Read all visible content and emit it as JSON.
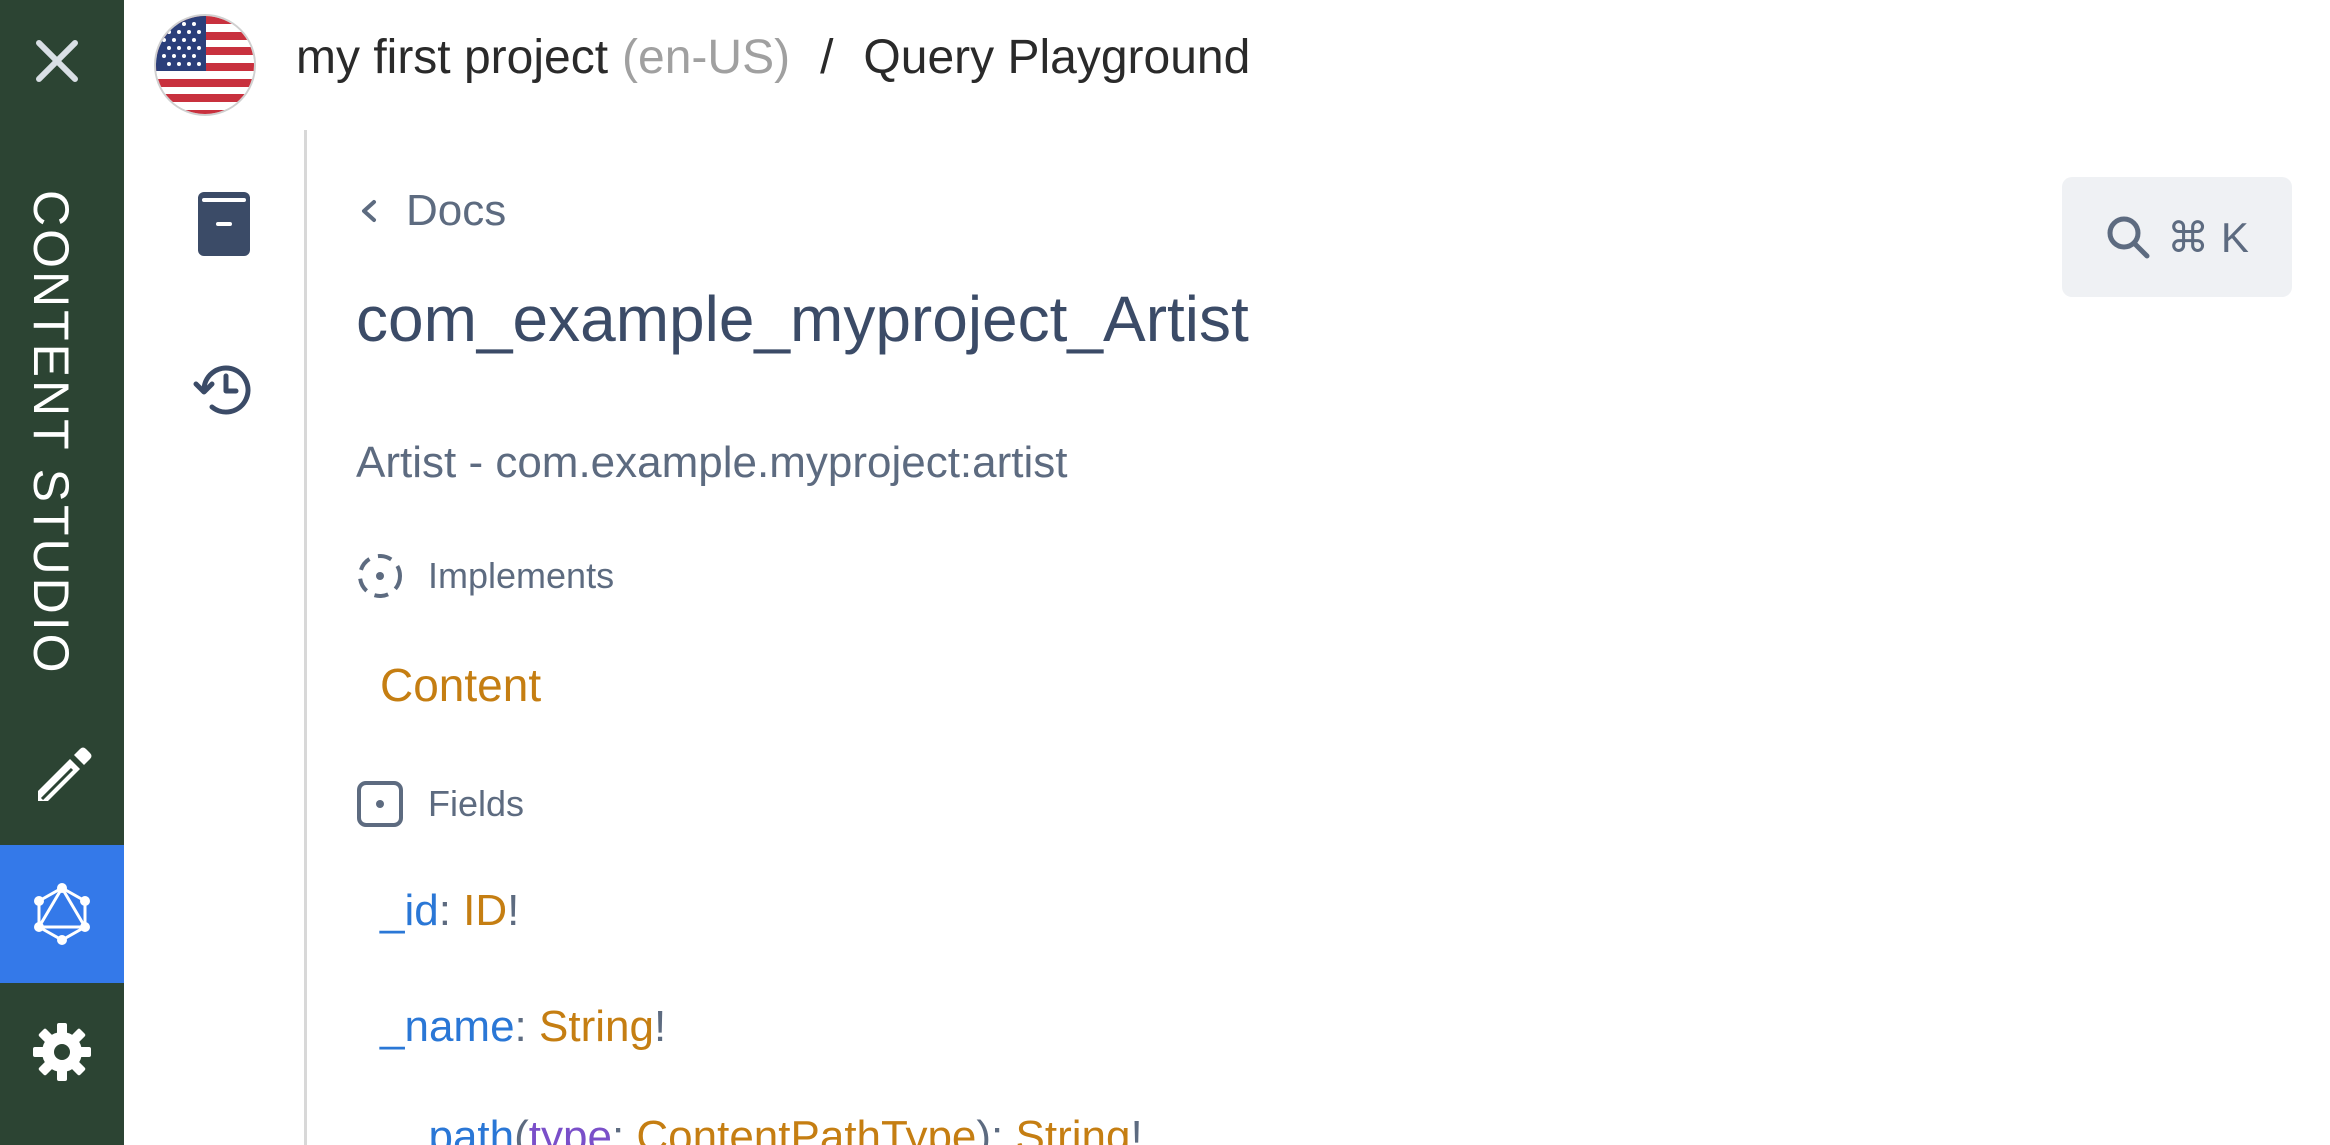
{
  "launcher": {
    "app_title": "CONTENT STUDIO",
    "accent_color": "#3479e9",
    "background_color": "#2c4433"
  },
  "header": {
    "project_name": "my first project",
    "language": "(en-US)",
    "separator": "/",
    "page_title": "Query Playground"
  },
  "docs": {
    "back_label": "Docs",
    "type_name": "com_example_myproject_Artist",
    "type_description": "Artist - com.example.myproject:artist",
    "implements_label": "Implements",
    "implements": [
      "Content"
    ],
    "fields_label": "Fields",
    "fields": [
      {
        "name": "_id",
        "type": "ID",
        "bang": "!"
      },
      {
        "name": "_name",
        "type": "String",
        "bang": "!"
      },
      {
        "name": "_path",
        "arg_name": "type",
        "arg_type": "ContentPathType",
        "type": "String",
        "bang": "!"
      }
    ]
  },
  "search": {
    "shortcut": "⌘ K"
  }
}
